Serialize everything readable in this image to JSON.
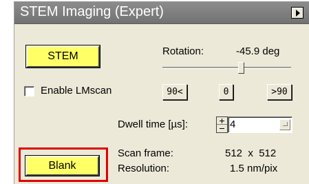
{
  "panel": {
    "title": "STEM Imaging (Expert)",
    "menu_icon": "triangle-right-icon"
  },
  "stem_button": {
    "label": "STEM",
    "color": "#ffff66"
  },
  "rotation": {
    "label": "Rotation:",
    "value": "-45.9 deg",
    "slider_fraction": 0.61
  },
  "lm_scan": {
    "label": "Enable LMscan",
    "checked": false
  },
  "rotate_buttons": {
    "minus90": "90<",
    "zero": "0",
    "plus90": ">90"
  },
  "dwell": {
    "label": "Dwell time [µs]:",
    "value": "4"
  },
  "scan_frame": {
    "label": "Scan frame:",
    "value": "512  x  512"
  },
  "resolution": {
    "label": "Resolution:",
    "value": "1.5 nm/pix"
  },
  "blank_button": {
    "label": "Blank",
    "highlight_color": "#e00000"
  }
}
